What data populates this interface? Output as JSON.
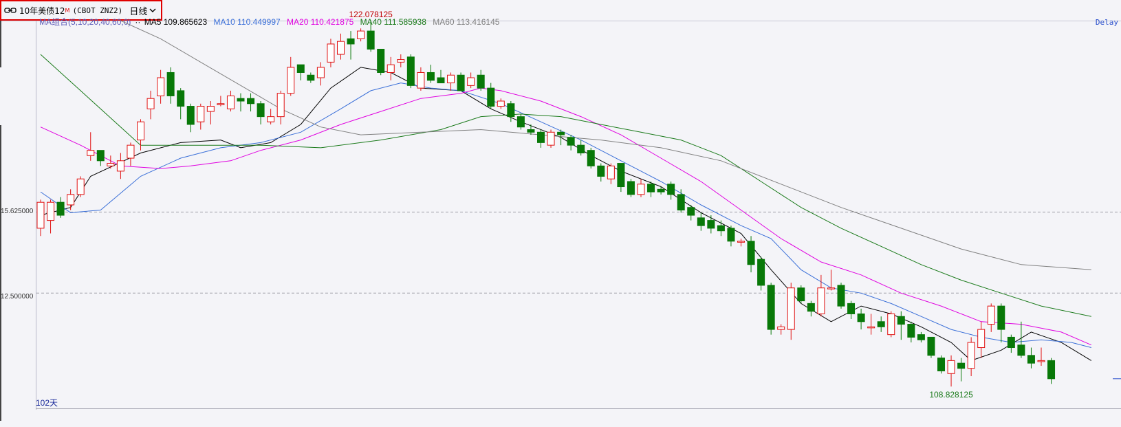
{
  "header": {
    "title": "10年美债12",
    "title_sup": "M",
    "code": "(CBOT ZNZ2)",
    "period": "日线",
    "delay_label": "Delay"
  },
  "legend": {
    "combo": "MA组合(5,10,20,40,60,0)",
    "dots": "··",
    "items": [
      {
        "label": "MA5 109.865623",
        "color": "#000000"
      },
      {
        "label": "MA10 110.449997",
        "color": "#3a6fd8"
      },
      {
        "label": "MA20 110.421875",
        "color": "#e000e0"
      },
      {
        "label": "MA40 111.585938",
        "color": "#1a7a1a"
      },
      {
        "label": "MA60 113.416145",
        "color": "#808080"
      }
    ]
  },
  "axis": {
    "tick_labels": [
      "15.625000",
      "12.500000"
    ],
    "days_label": "102天"
  },
  "chart_data": {
    "type": "candlestick",
    "y_range": [
      108.4,
      123.0
    ],
    "high_label": "122.078125",
    "low_label": "108.828125",
    "gridlines": [
      115.625,
      112.5
    ],
    "up_color": "#e01010",
    "down_color": "#087808",
    "candles": [
      [
        115.0,
        116.0,
        116.1,
        114.7
      ],
      [
        115.3,
        116.0,
        116.1,
        114.8
      ],
      [
        116.0,
        115.5,
        116.2,
        115.4
      ],
      [
        115.9,
        116.3,
        116.5,
        115.7
      ],
      [
        116.3,
        116.9,
        117.0,
        116.2
      ],
      [
        117.8,
        118.0,
        118.7,
        117.6
      ],
      [
        118.0,
        117.6,
        118.0,
        117.4
      ],
      [
        117.4,
        117.5,
        117.8,
        117.3
      ],
      [
        117.2,
        117.6,
        117.9,
        116.9
      ],
      [
        117.7,
        118.2,
        118.3,
        117.4
      ],
      [
        118.4,
        119.1,
        119.2,
        118.0
      ],
      [
        119.6,
        120.0,
        120.3,
        119.2
      ],
      [
        120.1,
        120.8,
        121.1,
        119.8
      ],
      [
        121.0,
        120.1,
        121.2,
        119.8
      ],
      [
        120.3,
        119.7,
        120.4,
        119.2
      ],
      [
        119.7,
        119.0,
        119.8,
        118.7
      ],
      [
        119.1,
        119.7,
        119.8,
        118.8
      ],
      [
        119.5,
        119.7,
        119.9,
        119.0
      ],
      [
        119.8,
        119.8,
        120.1,
        119.7
      ],
      [
        119.6,
        120.1,
        120.3,
        119.5
      ],
      [
        120.0,
        119.9,
        120.2,
        119.5
      ],
      [
        120.0,
        119.8,
        120.2,
        119.5
      ],
      [
        119.8,
        119.3,
        119.9,
        119.0
      ],
      [
        119.1,
        119.3,
        119.6,
        119.0
      ],
      [
        119.3,
        120.2,
        120.3,
        119.0
      ],
      [
        120.2,
        121.2,
        121.6,
        120.1
      ],
      [
        121.3,
        121.0,
        121.3,
        120.7
      ],
      [
        120.9,
        120.7,
        121.0,
        120.6
      ],
      [
        120.8,
        121.2,
        121.4,
        120.5
      ],
      [
        121.4,
        122.1,
        122.3,
        121.2
      ],
      [
        121.7,
        122.2,
        122.5,
        121.5
      ],
      [
        122.3,
        122.1,
        122.6,
        121.5
      ],
      [
        122.3,
        122.6,
        122.7,
        122.2
      ],
      [
        122.6,
        121.9,
        123.0,
        121.8
      ],
      [
        121.9,
        121.0,
        121.9,
        120.9
      ],
      [
        121.0,
        121.3,
        121.6,
        120.7
      ],
      [
        121.4,
        121.5,
        121.7,
        121.2
      ],
      [
        121.6,
        120.5,
        121.7,
        120.4
      ],
      [
        120.4,
        121.0,
        121.2,
        120.3
      ],
      [
        121.0,
        120.7,
        121.3,
        120.6
      ],
      [
        120.8,
        120.6,
        121.1,
        120.6
      ],
      [
        120.6,
        120.9,
        121.0,
        120.3
      ],
      [
        120.9,
        120.3,
        121.0,
        120.3
      ],
      [
        120.5,
        120.8,
        121.0,
        120.4
      ],
      [
        120.9,
        120.4,
        121.1,
        120.3
      ],
      [
        120.4,
        119.7,
        120.6,
        119.6
      ],
      [
        119.7,
        119.9,
        120.0,
        119.6
      ],
      [
        119.8,
        119.3,
        119.9,
        119.1
      ],
      [
        119.3,
        118.9,
        119.4,
        118.8
      ],
      [
        118.8,
        118.7,
        119.0,
        118.6
      ],
      [
        118.7,
        118.3,
        118.8,
        118.1
      ],
      [
        118.2,
        118.7,
        118.8,
        118.1
      ],
      [
        118.7,
        118.6,
        118.8,
        118.2
      ],
      [
        118.5,
        118.2,
        118.6,
        118.0
      ],
      [
        118.2,
        117.9,
        118.4,
        117.8
      ],
      [
        118.0,
        117.4,
        118.1,
        117.3
      ],
      [
        117.4,
        117.0,
        117.5,
        116.8
      ],
      [
        116.9,
        117.4,
        117.5,
        116.7
      ],
      [
        117.5,
        116.6,
        117.5,
        116.4
      ],
      [
        116.8,
        116.3,
        116.9,
        116.2
      ],
      [
        116.3,
        116.7,
        116.9,
        116.2
      ],
      [
        116.7,
        116.4,
        116.8,
        116.2
      ],
      [
        116.5,
        116.4,
        116.6,
        116.3
      ],
      [
        116.7,
        116.3,
        116.8,
        116.1
      ],
      [
        116.3,
        115.7,
        116.5,
        115.6
      ],
      [
        115.8,
        115.5,
        115.9,
        115.3
      ],
      [
        115.4,
        115.1,
        115.6,
        114.9
      ],
      [
        115.3,
        115.0,
        115.5,
        114.8
      ],
      [
        115.1,
        114.9,
        115.3,
        114.7
      ],
      [
        115.0,
        114.5,
        115.1,
        114.3
      ],
      [
        114.5,
        114.5,
        114.6,
        114.3
      ],
      [
        114.5,
        113.6,
        114.7,
        113.3
      ],
      [
        113.8,
        112.8,
        113.9,
        112.6
      ],
      [
        112.8,
        111.1,
        112.9,
        110.9
      ],
      [
        111.1,
        111.2,
        111.3,
        110.9
      ],
      [
        111.1,
        112.7,
        112.9,
        110.7
      ],
      [
        112.7,
        112.2,
        112.8,
        112.1
      ],
      [
        112.1,
        111.8,
        112.2,
        111.6
      ],
      [
        111.7,
        112.7,
        113.2,
        111.6
      ],
      [
        112.7,
        112.7,
        113.4,
        112.6
      ],
      [
        112.8,
        112.0,
        112.9,
        111.9
      ],
      [
        112.1,
        111.7,
        112.2,
        111.5
      ],
      [
        111.7,
        111.4,
        111.9,
        111.1
      ],
      [
        111.2,
        111.2,
        111.7,
        110.9
      ],
      [
        111.4,
        111.2,
        111.6,
        111.0
      ],
      [
        110.9,
        111.7,
        111.8,
        110.8
      ],
      [
        111.6,
        111.3,
        111.8,
        110.7
      ],
      [
        111.3,
        110.8,
        111.4,
        110.6
      ],
      [
        110.9,
        110.7,
        111.0,
        110.6
      ],
      [
        110.8,
        110.1,
        110.8,
        110.0
      ],
      [
        110.0,
        109.5,
        110.1,
        109.4
      ],
      [
        109.4,
        109.9,
        110.1,
        108.9
      ],
      [
        109.8,
        109.6,
        110.0,
        109.1
      ],
      [
        109.6,
        110.6,
        110.8,
        109.3
      ],
      [
        110.4,
        111.1,
        111.4,
        110.0
      ],
      [
        111.3,
        112.0,
        112.1,
        111.0
      ],
      [
        112.0,
        111.1,
        112.1,
        110.6
      ],
      [
        110.8,
        110.4,
        110.9,
        110.2
      ],
      [
        110.5,
        110.1,
        111.4,
        110.0
      ],
      [
        110.1,
        109.8,
        110.4,
        109.6
      ],
      [
        109.9,
        109.9,
        110.4,
        109.7
      ],
      [
        109.9,
        109.2,
        110.0,
        109.0
      ]
    ],
    "ma_series": [
      {
        "name": "MA5",
        "color": "#000000",
        "points": [
          [
            0,
            115.5
          ],
          [
            3,
            115.8
          ],
          [
            5,
            117.0
          ],
          [
            10,
            117.9
          ],
          [
            14,
            118.3
          ],
          [
            18,
            118.4
          ],
          [
            20,
            118.1
          ],
          [
            23,
            118.3
          ],
          [
            26,
            119.0
          ],
          [
            29,
            120.4
          ],
          [
            32,
            121.2
          ],
          [
            35,
            121.0
          ],
          [
            38,
            120.4
          ],
          [
            42,
            120.3
          ],
          [
            45,
            119.6
          ],
          [
            48,
            119.1
          ],
          [
            52,
            118.5
          ],
          [
            55,
            117.8
          ],
          [
            58,
            117.2
          ],
          [
            62,
            116.6
          ],
          [
            66,
            115.6
          ],
          [
            70,
            114.8
          ],
          [
            73,
            113.4
          ],
          [
            76,
            112.1
          ],
          [
            79,
            111.4
          ],
          [
            82,
            112.0
          ],
          [
            85,
            111.7
          ],
          [
            88,
            111.2
          ],
          [
            91,
            110.6
          ],
          [
            93,
            109.9
          ],
          [
            96,
            110.3
          ],
          [
            99,
            111.0
          ],
          [
            102,
            110.6
          ],
          [
            105,
            109.9
          ]
        ]
      },
      {
        "name": "MA10",
        "color": "#3a6fd8",
        "points": [
          [
            0,
            116.4
          ],
          [
            3,
            115.6
          ],
          [
            6,
            115.7
          ],
          [
            10,
            117.0
          ],
          [
            14,
            117.7
          ],
          [
            18,
            118.1
          ],
          [
            22,
            118.3
          ],
          [
            26,
            118.7
          ],
          [
            30,
            119.6
          ],
          [
            33,
            120.3
          ],
          [
            36,
            120.6
          ],
          [
            39,
            120.4
          ],
          [
            42,
            120.3
          ],
          [
            46,
            119.8
          ],
          [
            50,
            119.1
          ],
          [
            54,
            118.4
          ],
          [
            58,
            117.6
          ],
          [
            62,
            116.8
          ],
          [
            66,
            115.9
          ],
          [
            70,
            115.1
          ],
          [
            73,
            114.6
          ],
          [
            76,
            113.4
          ],
          [
            79,
            112.7
          ],
          [
            82,
            112.5
          ],
          [
            85,
            112.1
          ],
          [
            88,
            111.6
          ],
          [
            91,
            111.1
          ],
          [
            94,
            110.8
          ],
          [
            97,
            110.6
          ],
          [
            100,
            110.7
          ],
          [
            103,
            110.6
          ],
          [
            105,
            110.4
          ]
        ]
      },
      {
        "name": "MA20",
        "color": "#e000e0",
        "points": [
          [
            0,
            118.9
          ],
          [
            4,
            118.2
          ],
          [
            8,
            117.4
          ],
          [
            12,
            117.3
          ],
          [
            15,
            117.4
          ],
          [
            19,
            117.6
          ],
          [
            22,
            118.0
          ],
          [
            26,
            118.4
          ],
          [
            30,
            119.0
          ],
          [
            34,
            119.5
          ],
          [
            38,
            120.0
          ],
          [
            42,
            120.2
          ],
          [
            44,
            120.4
          ],
          [
            46,
            120.3
          ],
          [
            50,
            119.9
          ],
          [
            54,
            119.3
          ],
          [
            58,
            118.6
          ],
          [
            62,
            117.7
          ],
          [
            66,
            116.8
          ],
          [
            70,
            115.7
          ],
          [
            74,
            114.6
          ],
          [
            78,
            113.7
          ],
          [
            82,
            113.2
          ],
          [
            86,
            112.5
          ],
          [
            90,
            112.0
          ],
          [
            94,
            111.4
          ],
          [
            98,
            111.3
          ],
          [
            102,
            111.0
          ],
          [
            105,
            110.5
          ]
        ]
      },
      {
        "name": "MA40",
        "color": "#1a7a1a",
        "points": [
          [
            0,
            121.7
          ],
          [
            4,
            120.3
          ],
          [
            8,
            118.9
          ],
          [
            10,
            118.2
          ],
          [
            14,
            118.2
          ],
          [
            18,
            118.2
          ],
          [
            22,
            118.2
          ],
          [
            28,
            118.1
          ],
          [
            34,
            118.4
          ],
          [
            40,
            118.8
          ],
          [
            44,
            119.3
          ],
          [
            48,
            119.4
          ],
          [
            52,
            119.3
          ],
          [
            56,
            119.0
          ],
          [
            60,
            118.7
          ],
          [
            64,
            118.4
          ],
          [
            68,
            117.8
          ],
          [
            72,
            116.8
          ],
          [
            76,
            115.8
          ],
          [
            80,
            115.0
          ],
          [
            84,
            114.3
          ],
          [
            88,
            113.6
          ],
          [
            92,
            113.0
          ],
          [
            96,
            112.5
          ],
          [
            100,
            112.0
          ],
          [
            105,
            111.6
          ]
        ]
      },
      {
        "name": "MA60",
        "color": "#808080",
        "points": [
          [
            8,
            123.0
          ],
          [
            12,
            122.3
          ],
          [
            16,
            121.4
          ],
          [
            20,
            120.5
          ],
          [
            24,
            119.6
          ],
          [
            28,
            118.9
          ],
          [
            32,
            118.6
          ],
          [
            38,
            118.7
          ],
          [
            44,
            118.8
          ],
          [
            50,
            118.6
          ],
          [
            56,
            118.4
          ],
          [
            62,
            118.1
          ],
          [
            68,
            117.6
          ],
          [
            74,
            116.7
          ],
          [
            80,
            115.8
          ],
          [
            86,
            115.0
          ],
          [
            92,
            114.2
          ],
          [
            98,
            113.6
          ],
          [
            105,
            113.4
          ]
        ]
      }
    ]
  }
}
